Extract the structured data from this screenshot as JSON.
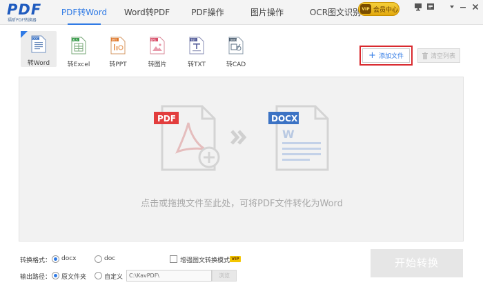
{
  "app": {
    "logo_text": "PDF",
    "logo_sub": "福昕PDF转换器"
  },
  "nav": {
    "tabs": [
      {
        "label": "PDF转Word",
        "active": true
      },
      {
        "label": "Word转PDF",
        "active": false
      },
      {
        "label": "PDF操作",
        "active": false
      },
      {
        "label": "图片操作",
        "active": false
      },
      {
        "label": "OCR图文识别",
        "active": false
      }
    ],
    "member_badge": "VIP",
    "member_label": "会员中心"
  },
  "tools": [
    {
      "label": "转Word",
      "icon": "word-doc-icon",
      "active": true
    },
    {
      "label": "转Excel",
      "icon": "excel-doc-icon",
      "active": false
    },
    {
      "label": "转PPT",
      "icon": "ppt-doc-icon",
      "active": false
    },
    {
      "label": "转图片",
      "icon": "image-doc-icon",
      "active": false
    },
    {
      "label": "转TXT",
      "icon": "txt-doc-icon",
      "active": false
    },
    {
      "label": "转CAD",
      "icon": "cad-doc-icon",
      "active": false
    }
  ],
  "toolbar": {
    "add_file": "添加文件",
    "clear_list": "清空列表"
  },
  "drop": {
    "src_badge": "PDF",
    "dst_badge": "DOCX",
    "hint": "点击或拖拽文件至此处，可将PDF文件转化为Word"
  },
  "options": {
    "format_label": "转换格式：",
    "format_docx": "docx",
    "format_doc": "doc",
    "enhance_label": "增强图文转换模式",
    "enhance_badge": "VIP",
    "output_label": "输出路径：",
    "output_source": "原文件夹",
    "output_custom": "自定义",
    "path_value": "C:\\KavPDF\\",
    "browse": "浏览",
    "start": "开始转换"
  },
  "colors": {
    "accent": "#2f7ae5",
    "pdf_red": "#e23d3d",
    "docx_blue": "#3c73c4",
    "highlight_border": "#d9292e"
  }
}
